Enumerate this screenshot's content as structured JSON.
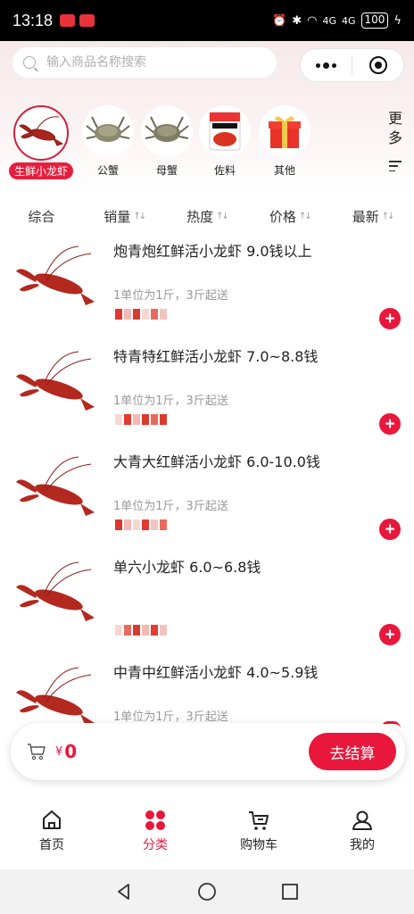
{
  "status": {
    "time": "13:18",
    "battery": "100",
    "net1": "4G",
    "net2": "4G"
  },
  "search": {
    "placeholder": "输入商品名称搜索"
  },
  "categories": [
    {
      "label": "生鲜小龙虾",
      "icon": "crayfish-icon",
      "active": true
    },
    {
      "label": "公蟹",
      "icon": "crab-icon"
    },
    {
      "label": "母蟹",
      "icon": "crab-icon"
    },
    {
      "label": "佐料",
      "icon": "seasoning-pack-icon"
    },
    {
      "label": "其他",
      "icon": "gift-box-icon"
    }
  ],
  "more_label": "更多",
  "sort": [
    "综合",
    "销量",
    "热度",
    "价格",
    "最新"
  ],
  "products": [
    {
      "name": "炮青炮红鲜活小龙虾 9.0钱以上",
      "desc": "1单位为1斤，3斤起送"
    },
    {
      "name": "特青特红鲜活小龙虾 7.0~8.8钱",
      "desc": "1单位为1斤，3斤起送"
    },
    {
      "name": "大青大红鲜活小龙虾 6.0-10.0钱",
      "desc": "1单位为1斤，3斤起送"
    },
    {
      "name": "单六小龙虾 6.0~6.8钱",
      "desc": ""
    },
    {
      "name": "中青中红鲜活小龙虾 4.0~5.9钱",
      "desc": "1单位为1斤，3斤起送"
    }
  ],
  "cart": {
    "currency": "¥",
    "total": "0",
    "checkout_label": "去结算"
  },
  "tabs": [
    {
      "label": "首页",
      "icon": "home-icon"
    },
    {
      "label": "分类",
      "icon": "category-icon",
      "active": true
    },
    {
      "label": "购物车",
      "icon": "cart-icon"
    },
    {
      "label": "我的",
      "icon": "user-icon"
    }
  ],
  "colors": {
    "accent": "#e8173b",
    "header_bg": "#f6e9ea"
  }
}
